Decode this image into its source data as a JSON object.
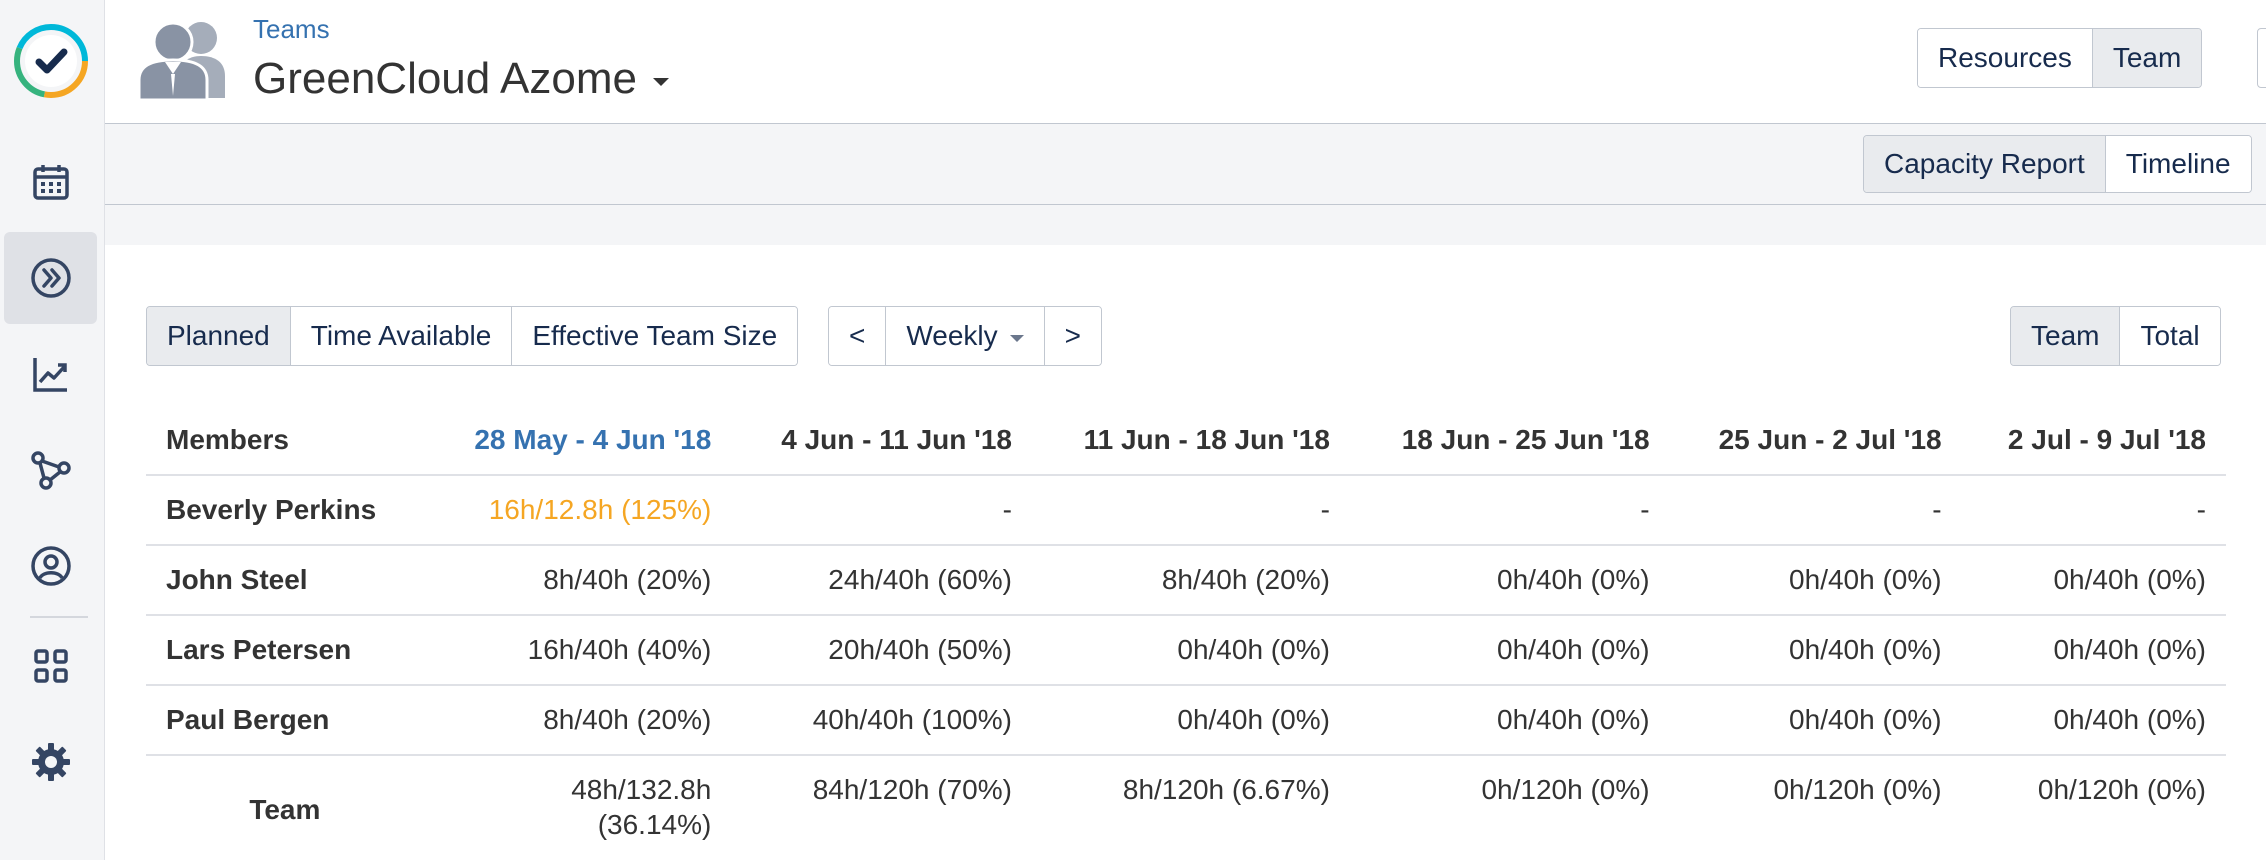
{
  "sidebar": {
    "items": [
      {
        "icon": "calendar-icon"
      },
      {
        "icon": "double-chevron-right-icon",
        "active": true
      },
      {
        "icon": "trend-chart-icon"
      },
      {
        "icon": "network-icon"
      },
      {
        "icon": "user-circle-icon"
      },
      {
        "icon": "apps-grid-icon"
      },
      {
        "icon": "gear-icon"
      }
    ]
  },
  "header": {
    "breadcrumb": "Teams",
    "title": "GreenCloud Azome",
    "view_toggle": [
      "Resources",
      "Team"
    ],
    "view_selected": "Team"
  },
  "subheader": {
    "report_toggle": [
      "Capacity Report",
      "Timeline"
    ],
    "report_selected": "Capacity Report"
  },
  "controls": {
    "metrics": [
      "Planned",
      "Time Available",
      "Effective Team Size"
    ],
    "metric_selected": "Planned",
    "prev": "<",
    "period": "Weekly",
    "next": ">",
    "scope": [
      "Team",
      "Total"
    ],
    "scope_selected": "Team"
  },
  "table": {
    "headers": [
      "Members",
      "28 May - 4 Jun '18",
      "4 Jun - 11 Jun '18",
      "11 Jun - 18 Jun '18",
      "18 Jun - 25 Jun '18",
      "25 Jun - 2 Jul '18",
      "2 Jul - 9 Jul '18"
    ],
    "rows": [
      {
        "name": "Beverly Perkins",
        "cells": [
          "16h/12.8h (125%)",
          "-",
          "-",
          "-",
          "-",
          "-"
        ]
      },
      {
        "name": "John Steel",
        "cells": [
          "8h/40h (20%)",
          "24h/40h (60%)",
          "8h/40h (20%)",
          "0h/40h (0%)",
          "0h/40h (0%)",
          "0h/40h (0%)"
        ]
      },
      {
        "name": "Lars Petersen",
        "cells": [
          "16h/40h (40%)",
          "20h/40h (50%)",
          "0h/40h (0%)",
          "0h/40h (0%)",
          "0h/40h (0%)",
          "0h/40h (0%)"
        ]
      },
      {
        "name": "Paul Bergen",
        "cells": [
          "8h/40h (20%)",
          "40h/40h (100%)",
          "0h/40h (0%)",
          "0h/40h (0%)",
          "0h/40h (0%)",
          "0h/40h (0%)"
        ]
      }
    ],
    "team_row": {
      "name": "Team",
      "cells": [
        {
          "line1": "48h/132.8h",
          "line2": "(36.14%)"
        },
        {
          "line1": "84h/120h (70%)",
          "line2": ""
        },
        {
          "line1": "8h/120h (6.67%)",
          "line2": ""
        },
        {
          "line1": "0h/120h (0%)",
          "line2": ""
        },
        {
          "line1": "0h/120h (0%)",
          "line2": ""
        },
        {
          "line1": "0h/120h (0%)",
          "line2": ""
        }
      ]
    }
  },
  "colors": {
    "accent": "#3572b0",
    "over_capacity": "#f5a623"
  }
}
